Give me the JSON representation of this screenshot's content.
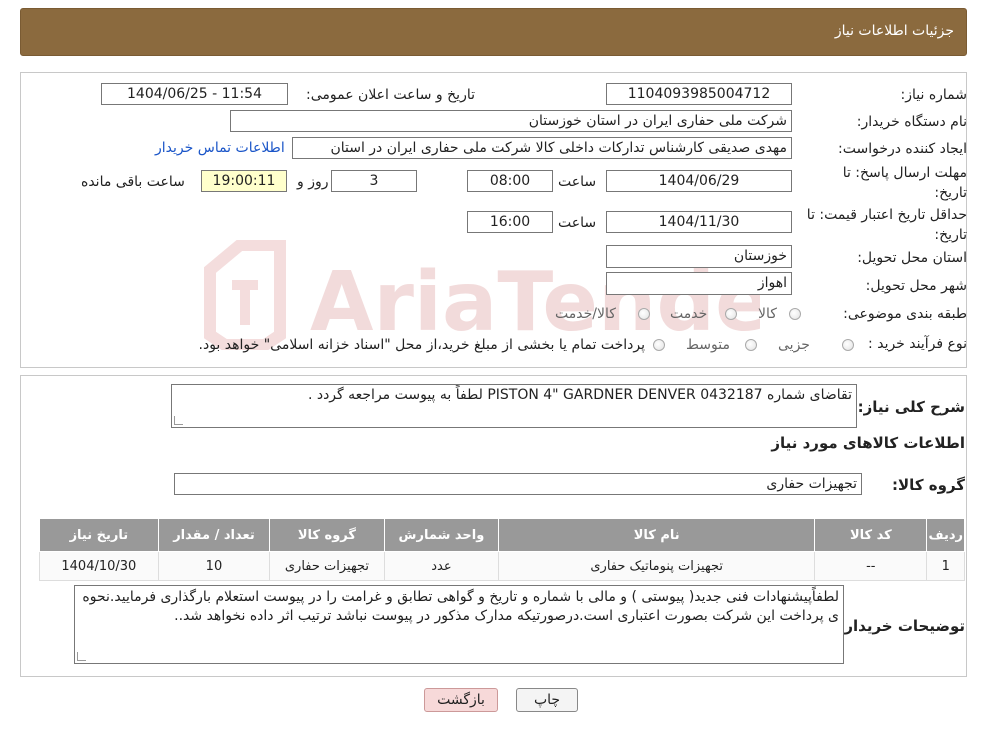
{
  "header": {
    "title": "جزئیات اطلاعات نیاز"
  },
  "watermark": {
    "text": "AriaTender.neT"
  },
  "form": {
    "need_number_label": "شماره نیاز:",
    "need_number": "1104093985004712",
    "announce_label": "تاریخ و ساعت اعلان عمومی:",
    "announce_value": "1404/06/25 - 11:54",
    "buyer_org_label": "نام دستگاه خریدار:",
    "buyer_org": "شرکت ملی حفاری ایران در استان خوزستان",
    "creator_label": "ایجاد کننده درخواست:",
    "creator": "مهدی صدیقی کارشناس تداركات داخلی كالا شرکت ملی حفاری ایران در استان",
    "contact_link": "اطلاعات تماس خریدار",
    "deadline_label_1": "مهلت ارسال پاسخ: تا",
    "deadline_label_2": "تاریخ:",
    "deadline_date": "1404/06/29",
    "time_label": "ساعت",
    "deadline_time": "08:00",
    "days_value": "3",
    "days_label": "روز و",
    "remaining_time": "19:00:11",
    "remaining_label": "ساعت باقی مانده",
    "validity_label_1": "حداقل تاریخ اعتبار قیمت: تا",
    "validity_label_2": "تاریخ:",
    "validity_date": "1404/11/30",
    "validity_time": "16:00",
    "province_label": "استان محل تحویل:",
    "province": "خوزستان",
    "city_label": "شهر محل تحویل:",
    "city": "اهواز",
    "category_label": "طبقه بندی موضوعی:",
    "category_options": [
      "کالا",
      "خدمت",
      "کالا/خدمت"
    ],
    "process_label": "نوع فرآیند خرید :",
    "process_options": [
      "جزیی",
      "متوسط"
    ],
    "process_note": "پرداخت تمام یا بخشی از مبلغ خرید،از محل \"اسناد خزانه اسلامی\" خواهد بود."
  },
  "summary": {
    "desc_label": "شرح کلی نیاز:",
    "desc_text": "تقاضای شماره PISTON 4\" GARDNER DENVER 0432187 لطفاً به پیوست مراجعه گردد .",
    "items_title": "اطلاعات کالاهای مورد نیاز",
    "group_label": "گروه کالا:",
    "group_value": "تجهیزات حفاری",
    "table": {
      "headers": [
        "ردیف",
        "کد کالا",
        "نام کالا",
        "واحد شمارش",
        "گروه کالا",
        "تعداد / مقدار",
        "تاریخ نیاز"
      ],
      "rows": [
        [
          "1",
          "--",
          "تجهیزات پنوماتیک حفاری",
          "عدد",
          "تجهیزات حفاری",
          "10",
          "1404/10/30"
        ]
      ]
    },
    "buyer_notes_label": "توضیحات خریدار:",
    "buyer_notes": "لطفاًپیشنهادات فنی جدید( پیوستی ) و مالی با شماره و تاریخ و گواهی تطابق و غرامت را در پیوست استعلام بارگذاری فرمایید.نحوه ی پرداخت این شرکت بصورت اعتباری است.درصورتیکه مدارک مذکور در پیوست نباشد ترتیب اثر داده نخواهد شد.."
  },
  "buttons": {
    "print": "چاپ",
    "back": "بازگشت"
  },
  "colors": {
    "header_bg": "#8b6a3e",
    "table_header_bg": "#999999",
    "back_button_bg": "#f7d9d9"
  }
}
